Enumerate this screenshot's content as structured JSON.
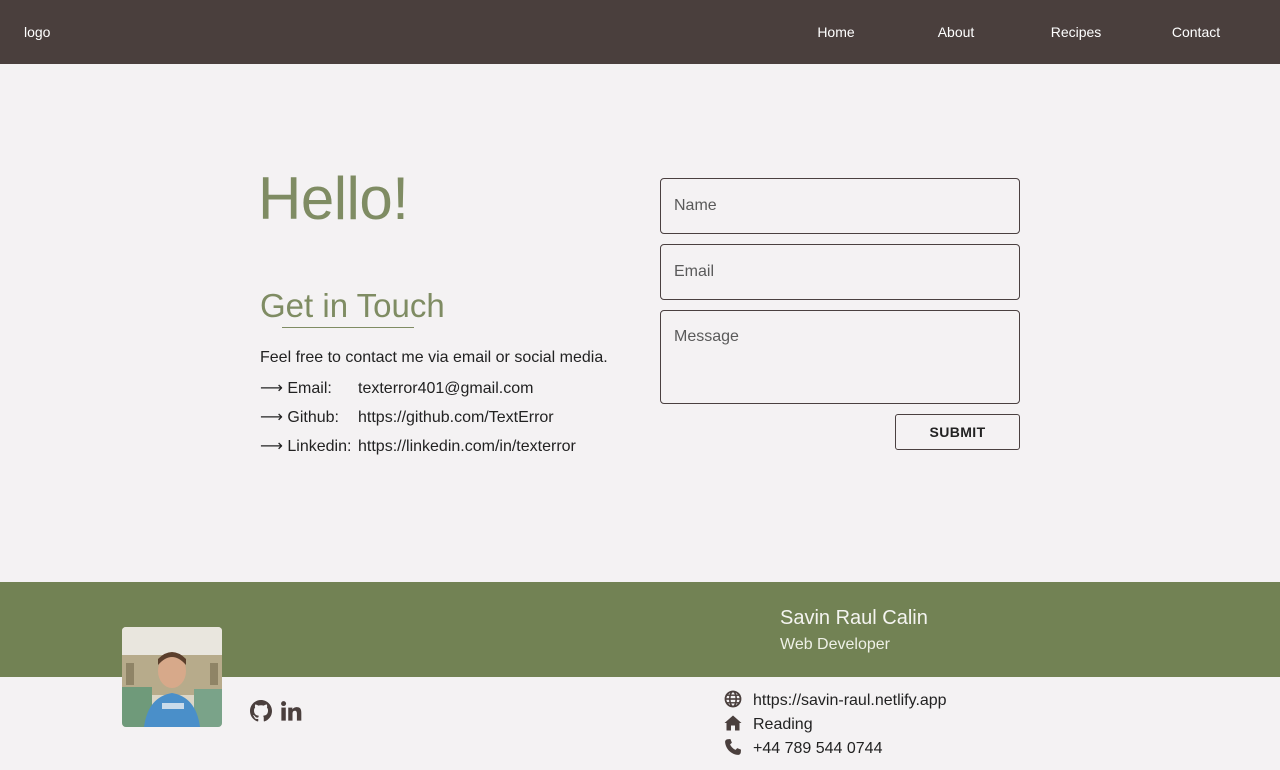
{
  "nav": {
    "logo": "logo",
    "links": [
      "Home",
      "About",
      "Recipes",
      "Contact"
    ]
  },
  "contact": {
    "hello": "Hello!",
    "heading": "Get in Touch",
    "intro": "Feel free to contact me via email or social media.",
    "rows": [
      {
        "label": "⟶ Email:",
        "value": "texterror401@gmail.com"
      },
      {
        "label": "⟶ Github:",
        "value": "https://github.com/TextError"
      },
      {
        "label": "⟶ Linkedin:",
        "value": "https://linkedin.com/in/texterror"
      }
    ]
  },
  "form": {
    "name_placeholder": "Name",
    "email_placeholder": "Email",
    "message_placeholder": "Message",
    "submit_label": "SUBMIT"
  },
  "footer": {
    "name": "Savin Raul Calin",
    "role": "Web Developer",
    "social_icons": [
      "github-icon",
      "linkedin-icon"
    ],
    "info": [
      {
        "icon": "globe-icon",
        "text": "https://savin-raul.netlify.app"
      },
      {
        "icon": "home-icon",
        "text": "Reading"
      },
      {
        "icon": "phone-icon",
        "text": "+44 789 544 0744"
      }
    ]
  },
  "colors": {
    "navbar": "#4a3f3d",
    "accent_green": "#7f8c63",
    "footer_band": "#728254",
    "background": "#f4f2f3"
  }
}
